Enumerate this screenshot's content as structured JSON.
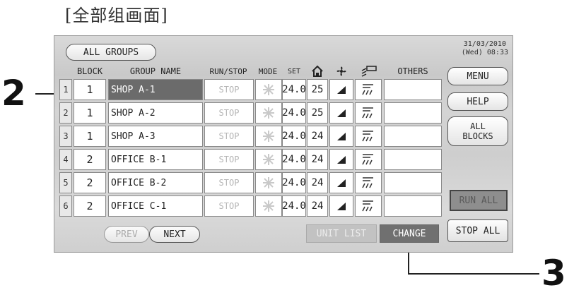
{
  "caption": "[全部组画面]",
  "callouts": {
    "left": "2",
    "right": "3"
  },
  "screen": {
    "title_button": "ALL GROUPS",
    "date": "31/03/2010",
    "time": "(Wed) 08:33",
    "columns": {
      "block": "BLOCK",
      "group_name": "GROUP NAME",
      "run_stop": "RUN/STOP",
      "mode": "MODE",
      "set": "SET",
      "others": "OTHERS"
    },
    "rows": [
      {
        "no": "1",
        "block": "1",
        "name": "SHOP A-1",
        "status": "STOP",
        "set": "24.0",
        "room": "25"
      },
      {
        "no": "2",
        "block": "1",
        "name": "SHOP A-2",
        "status": "STOP",
        "set": "24.0",
        "room": "25"
      },
      {
        "no": "3",
        "block": "1",
        "name": "SHOP A-3",
        "status": "STOP",
        "set": "24.0",
        "room": "24"
      },
      {
        "no": "4",
        "block": "2",
        "name": "OFFICE B-1",
        "status": "STOP",
        "set": "24.0",
        "room": "24"
      },
      {
        "no": "5",
        "block": "2",
        "name": "OFFICE B-2",
        "status": "STOP",
        "set": "24.0",
        "room": "24"
      },
      {
        "no": "6",
        "block": "2",
        "name": "OFFICE C-1",
        "status": "STOP",
        "set": "24.0",
        "room": "24"
      }
    ],
    "selected_row": 0,
    "buttons": {
      "menu": "MENU",
      "help": "HELP",
      "all_blocks_1": "ALL",
      "all_blocks_2": "BLOCKS",
      "run_all": "RUN ALL",
      "stop_all": "STOP ALL",
      "prev": "PREV",
      "next": "NEXT",
      "unit_list": "UNIT LIST",
      "change": "CHANGE"
    },
    "icons": {
      "room_temp": "house-icon",
      "fan": "fan-icon",
      "louver": "louver-icon",
      "mode": "snowflake-icon",
      "fan_speed": "fan-speed-icon"
    }
  }
}
